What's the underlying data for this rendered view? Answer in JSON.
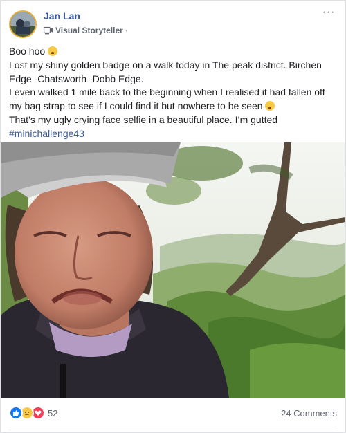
{
  "post": {
    "author": "Jan Lan",
    "role": "Visual Storyteller",
    "dot": "·",
    "more": "···",
    "lines": [
      "Boo hoo",
      "Lost my shiny golden badge on a walk today in The peak district. Birchen Edge -Chatsworth -Dobb Edge.",
      "I even walked 1 mile back to the beginning when I realised it had fallen off my bag strap to see if I could find it but nowhere to be seen",
      "That’s my ugly crying face selfie in a beautiful place. I’m gutted"
    ],
    "hashtag": "#minichallenge43"
  },
  "reactions": {
    "icons": [
      "like-icon",
      "sad-icon",
      "love-icon"
    ],
    "count": "52",
    "comments": "24 Comments"
  },
  "colors": {
    "link": "#385898",
    "like": "#1877f2",
    "love": "#f33e58",
    "sad": "#f7c948"
  }
}
